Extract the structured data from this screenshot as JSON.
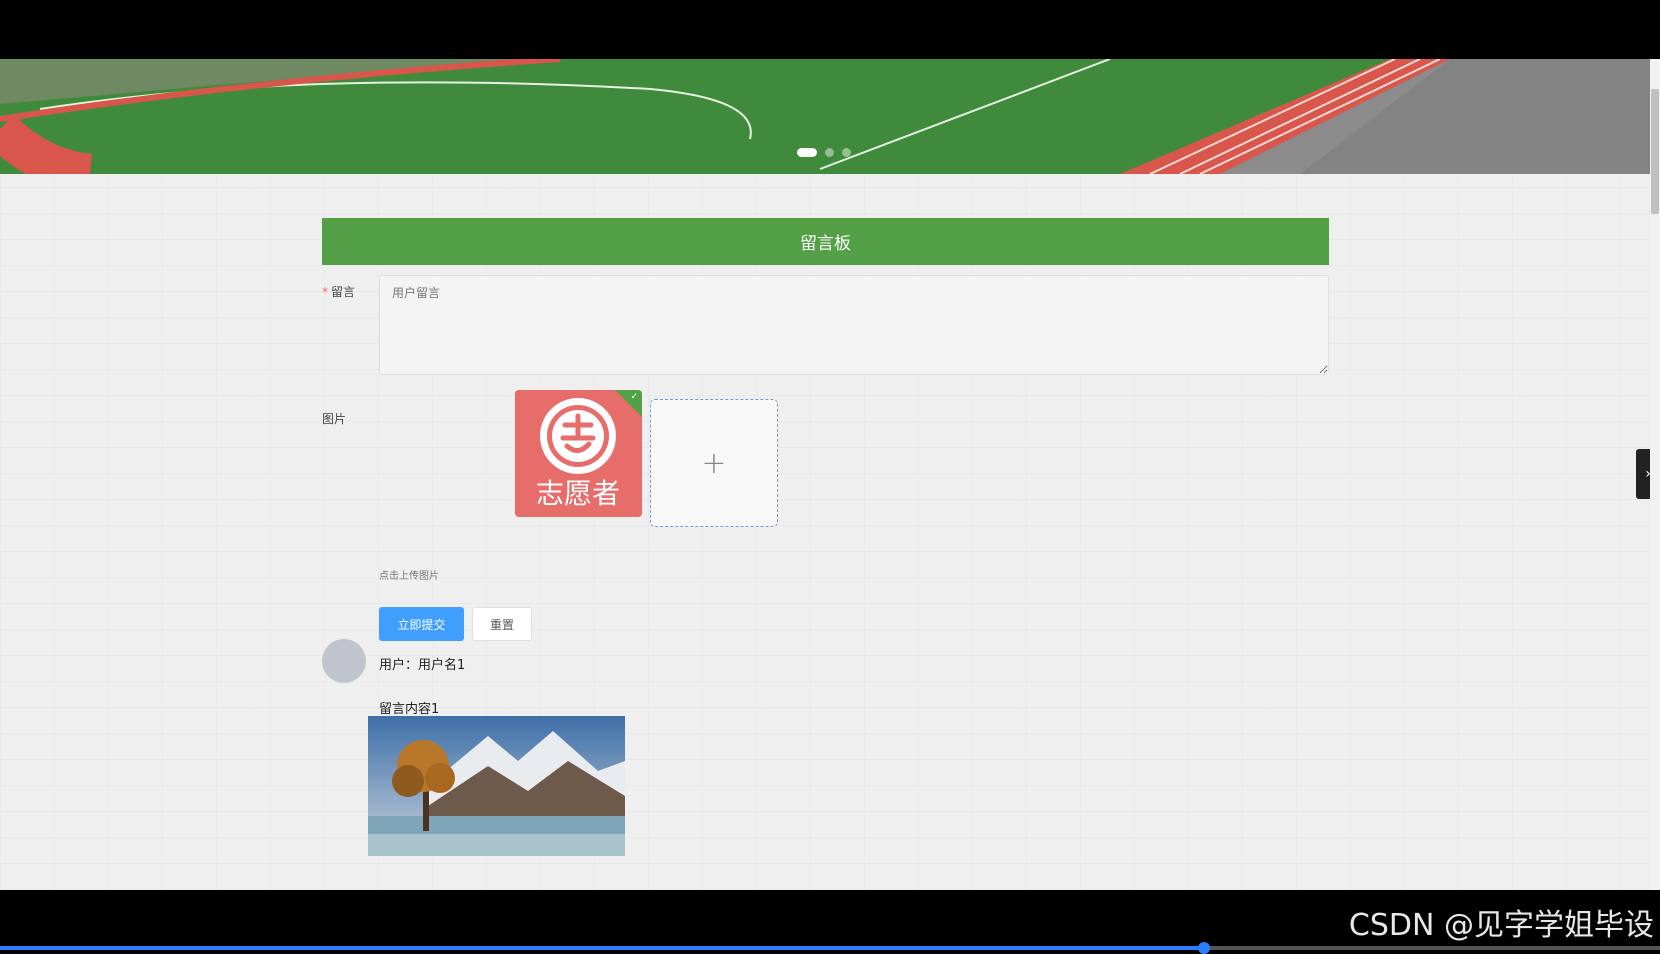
{
  "board": {
    "title": "留言板"
  },
  "form": {
    "message_label": "留言",
    "message_placeholder": "用户留言",
    "image_label": "图片",
    "upload_plus": "+",
    "upload_hint": "点击上传图片",
    "submit_label": "立即提交",
    "reset_label": "重置"
  },
  "uploaded_image": {
    "icon": "volunteer-logo-icon",
    "caption_text": "志愿者",
    "check": "✓"
  },
  "carousel": {
    "slide_count": 3,
    "active_index": 0
  },
  "comments": [
    {
      "user_text": "用户：用户名1",
      "content": "留言内容1"
    }
  ],
  "side_tab": {
    "icon": "chevron-right-icon",
    "glyph": "›"
  },
  "video_overlay": {
    "watermark": "CSDN @见字学姐毕设",
    "progress": 0.725
  },
  "colors": {
    "title_bar": "#53a046",
    "submit": "#409eff",
    "required": "#f56c6c"
  }
}
